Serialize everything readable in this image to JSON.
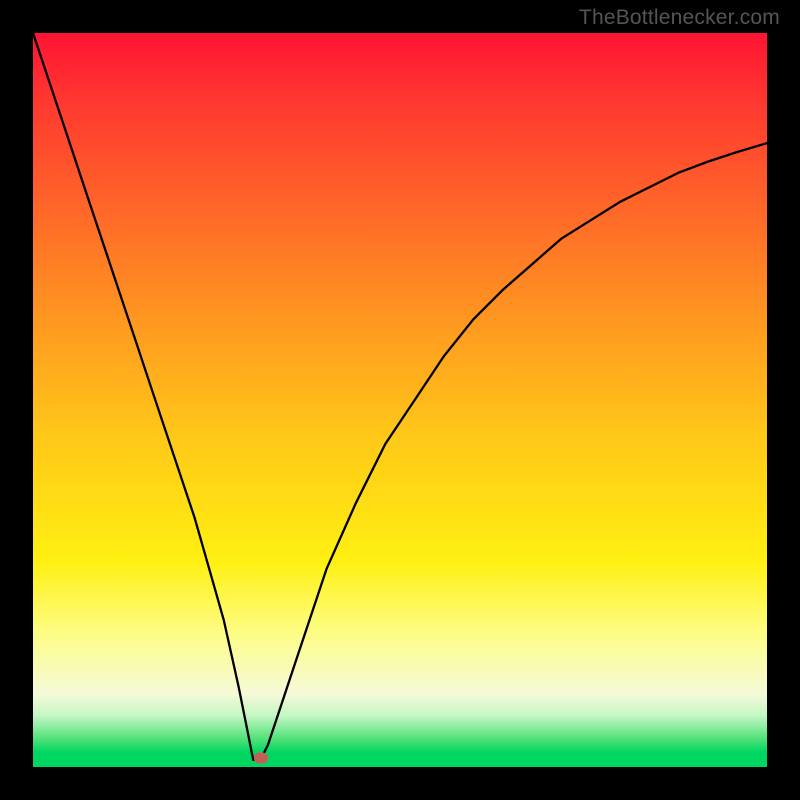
{
  "watermark": "TheBottlenecker.com",
  "chart_data": {
    "type": "line",
    "title": "",
    "xlabel": "",
    "ylabel": "",
    "xlim": [
      0,
      100
    ],
    "ylim": [
      0,
      100
    ],
    "gradient_semantics": "top=red=bad, bottom=green=good",
    "curve_note": "V-shaped bottleneck curve; minimum near x≈30",
    "x": [
      0,
      4,
      8,
      12,
      14,
      16,
      18,
      20,
      22,
      24,
      26,
      28,
      29,
      30,
      31,
      32,
      34,
      36,
      38,
      40,
      44,
      48,
      52,
      56,
      60,
      64,
      68,
      72,
      76,
      80,
      84,
      88,
      92,
      96,
      100
    ],
    "values": [
      100,
      88,
      76,
      64,
      58,
      52,
      46,
      40,
      34,
      27,
      20,
      11,
      6,
      1,
      1,
      3,
      9,
      15,
      21,
      27,
      36,
      44,
      50,
      56,
      61,
      65,
      68.5,
      72,
      74.5,
      77,
      79,
      81,
      82.5,
      83.8,
      85
    ],
    "marker": {
      "x": 31,
      "y": 1.2,
      "color": "#c06058"
    }
  }
}
